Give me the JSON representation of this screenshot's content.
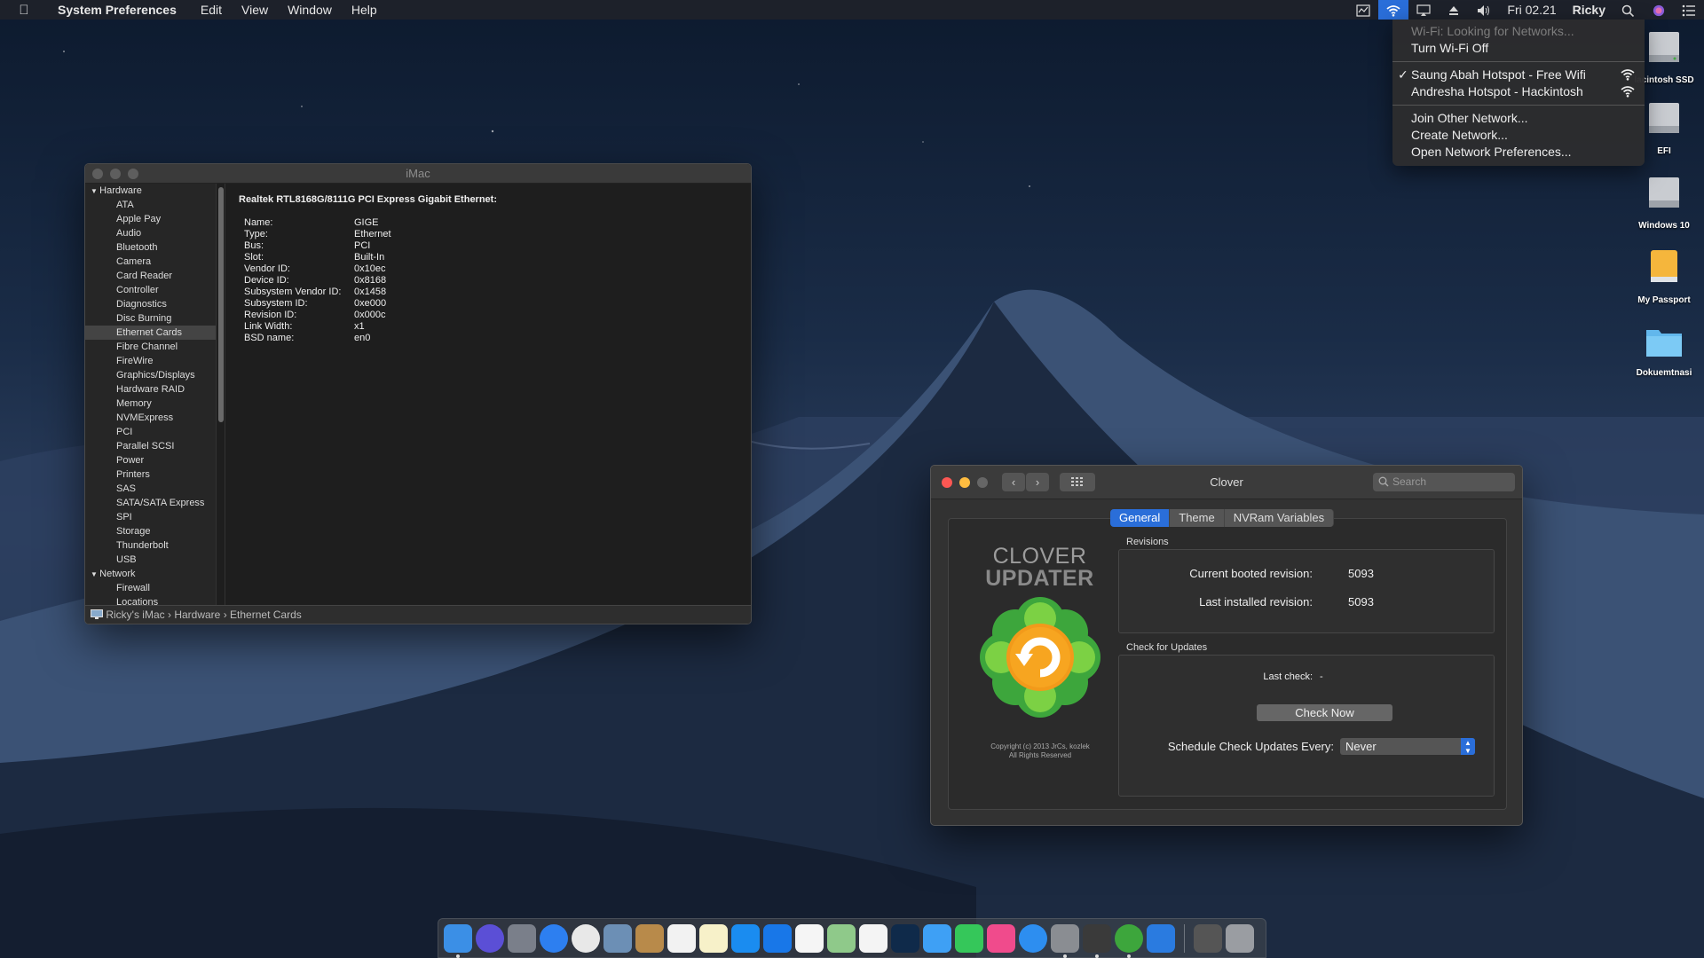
{
  "menubar": {
    "app_name": "System Preferences",
    "menus": [
      "Edit",
      "View",
      "Window",
      "Help"
    ],
    "clock": "Fri 02.21",
    "user": "Ricky"
  },
  "wifi_menu": {
    "status": "Wi-Fi: Looking for Networks...",
    "toggle": "Turn Wi-Fi Off",
    "networks": [
      {
        "name": "Saung Abah Hotspot - Free Wifi",
        "checked": true
      },
      {
        "name": "Andresha Hotspot - Hackintosh",
        "checked": false
      }
    ],
    "actions": [
      "Join Other Network...",
      "Create Network...",
      "Open Network Preferences..."
    ]
  },
  "desktop_icons": [
    {
      "label": "lacintosh SSD",
      "icon": "hard-drive-icon"
    },
    {
      "label": "EFI",
      "icon": "hard-drive-icon"
    },
    {
      "label": "Windows 10",
      "icon": "hard-drive-icon"
    },
    {
      "label": "My Passport",
      "icon": "external-drive-icon"
    },
    {
      "label": "Dokuemtnasi",
      "icon": "folder-icon"
    }
  ],
  "system_info": {
    "title": "iMac",
    "sidebar": [
      {
        "label": "Hardware",
        "group": true
      },
      {
        "label": "ATA"
      },
      {
        "label": "Apple Pay"
      },
      {
        "label": "Audio"
      },
      {
        "label": "Bluetooth"
      },
      {
        "label": "Camera"
      },
      {
        "label": "Card Reader"
      },
      {
        "label": "Controller"
      },
      {
        "label": "Diagnostics"
      },
      {
        "label": "Disc Burning"
      },
      {
        "label": "Ethernet Cards",
        "selected": true
      },
      {
        "label": "Fibre Channel"
      },
      {
        "label": "FireWire"
      },
      {
        "label": "Graphics/Displays"
      },
      {
        "label": "Hardware RAID"
      },
      {
        "label": "Memory"
      },
      {
        "label": "NVMExpress"
      },
      {
        "label": "PCI"
      },
      {
        "label": "Parallel SCSI"
      },
      {
        "label": "Power"
      },
      {
        "label": "Printers"
      },
      {
        "label": "SAS"
      },
      {
        "label": "SATA/SATA Express"
      },
      {
        "label": "SPI"
      },
      {
        "label": "Storage"
      },
      {
        "label": "Thunderbolt"
      },
      {
        "label": "USB"
      },
      {
        "label": "Network",
        "group": true
      },
      {
        "label": "Firewall"
      },
      {
        "label": "Locations"
      }
    ],
    "heading": "Realtek RTL8168G/8111G PCI Express Gigabit Ethernet:",
    "details": [
      {
        "key": "Name:",
        "value": "GIGE"
      },
      {
        "key": "Type:",
        "value": "Ethernet"
      },
      {
        "key": "Bus:",
        "value": "PCI"
      },
      {
        "key": "Slot:",
        "value": "Built-In"
      },
      {
        "key": "Vendor ID:",
        "value": "0x10ec"
      },
      {
        "key": "Device ID:",
        "value": "0x8168"
      },
      {
        "key": "Subsystem Vendor ID:",
        "value": "0x1458"
      },
      {
        "key": "Subsystem ID:",
        "value": "0xe000"
      },
      {
        "key": "Revision ID:",
        "value": "0x000c"
      },
      {
        "key": "Link Width:",
        "value": "x1"
      },
      {
        "key": "BSD name:",
        "value": "en0"
      }
    ],
    "path": [
      "Ricky's iMac",
      "Hardware",
      "Ethernet Cards"
    ]
  },
  "clover": {
    "title": "Clover",
    "search_placeholder": "Search",
    "tabs": [
      "General",
      "Theme",
      "NVRam Variables"
    ],
    "logo_line1": "CLOVER",
    "logo_line2": "UPDATER",
    "copyright_line1": "Copyright (c) 2013 JrCs, kozlek",
    "copyright_line2": "All Rights Reserved",
    "revisions_label": "Revisions",
    "current_booted_label": "Current booted revision:",
    "current_booted_value": "5093",
    "last_installed_label": "Last installed revision:",
    "last_installed_value": "5093",
    "check_label": "Check for Updates",
    "last_check_label": "Last check:",
    "last_check_value": "-",
    "check_button": "Check Now",
    "schedule_label": "Schedule Check Updates Every:",
    "schedule_value": "Never"
  },
  "dock_apps": [
    "finder-icon",
    "siri-icon",
    "launchpad-icon",
    "safari-icon",
    "chrome-icon",
    "preview-icon",
    "contacts-icon",
    "calendar-icon",
    "notes-icon",
    "plus-app-icon",
    "plus-app2-icon",
    "reminders-icon",
    "maps-icon",
    "photos-icon",
    "photoshop-icon",
    "messages-icon",
    "facetime-icon",
    "itunes-icon",
    "app-store-icon",
    "system-preferences-icon",
    "xcode-icon",
    "clover-icon",
    "activity-icon",
    "downloads-stack-icon",
    "trash-icon"
  ]
}
